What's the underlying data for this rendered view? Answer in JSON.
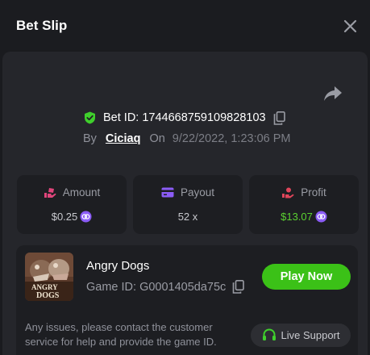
{
  "header": {
    "title": "Bet Slip"
  },
  "bet": {
    "id_text": "Bet ID: 174466875910982810​3",
    "by_label": "By",
    "username": "Ciciaq",
    "on_label": "On",
    "datetime": "9/22/2022, 1:23:06 PM"
  },
  "stats": [
    {
      "label": "Amount",
      "value": "$0.25",
      "icon": "wallet-hand-icon"
    },
    {
      "label": "Payout",
      "value": "52 x",
      "icon": "card-icon"
    },
    {
      "label": "Profit",
      "value": "$13.07",
      "icon": "money-hand-icon"
    }
  ],
  "game": {
    "name": "Angry Dogs",
    "id_text": "Game ID: G0001405da75c",
    "thumb_text_1": "ANGRY",
    "thumb_text_2": "DOGS",
    "play_label": "Play Now"
  },
  "support": {
    "text": "Any issues, please contact the customer service for help and provide the game ID.",
    "button_label": "Live Support"
  },
  "colors": {
    "background": "#1a1b1f",
    "panel": "#25262b",
    "card": "#1d1e22",
    "accent_green": "#3bc117",
    "profit_green": "#5bd031",
    "shield_green": "#3fcf2c",
    "coin_purple": "#8b5cf6",
    "amount_pink": "#e0457b",
    "payout_purple": "#8b5cf6",
    "profit_red": "#e0455a"
  }
}
